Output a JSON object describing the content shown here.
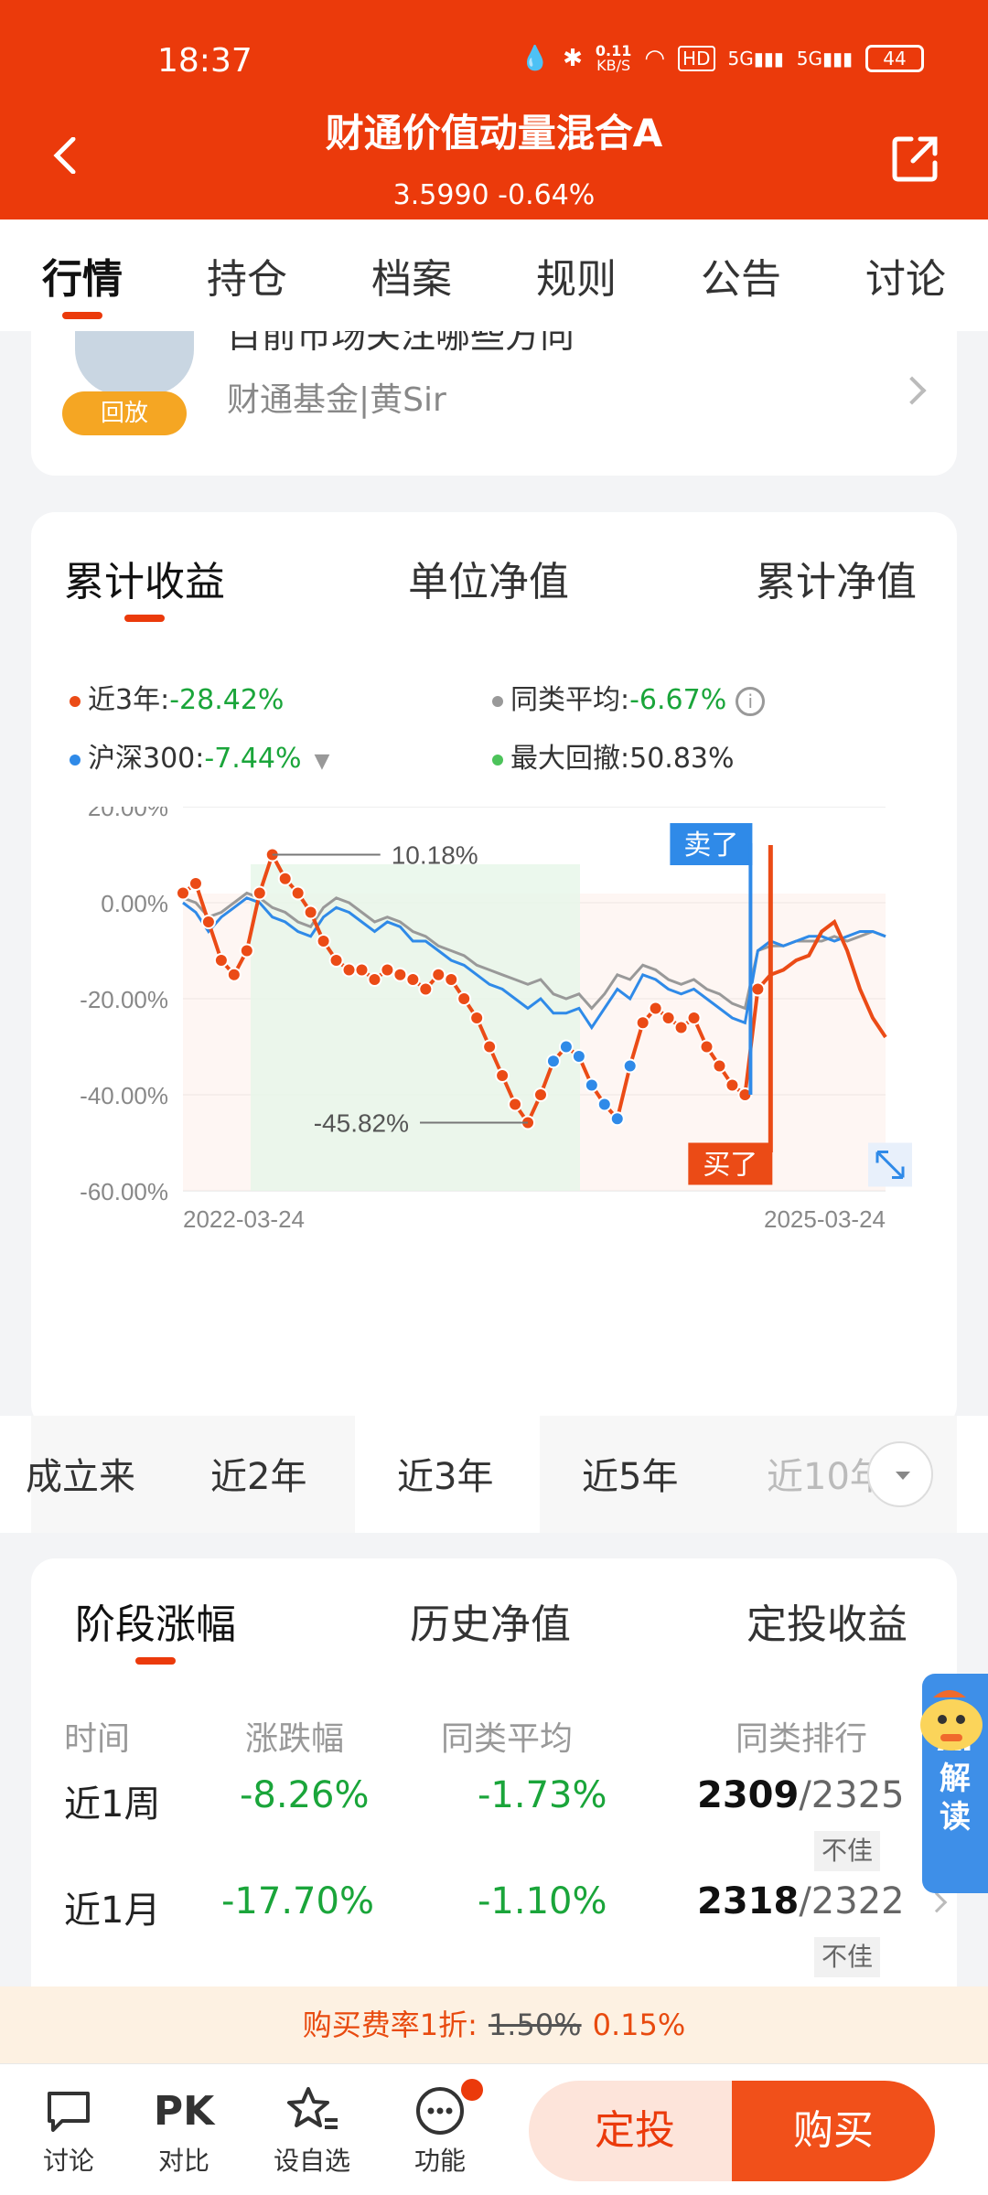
{
  "status_bar": {
    "time": "18:37",
    "net_speed_top": "0.11",
    "net_speed_unit": "KB/S",
    "battery": "44"
  },
  "header": {
    "title": "财通价值动量混合A",
    "subtitle": "3.5990 -0.64%"
  },
  "tabs": [
    {
      "label": "行情",
      "active": true
    },
    {
      "label": "持仓"
    },
    {
      "label": "档案"
    },
    {
      "label": "规则"
    },
    {
      "label": "公告"
    },
    {
      "label": "讨论"
    }
  ],
  "live": {
    "title": "目前市场关注哪些方向",
    "author": "财通基金|黄Sir",
    "badge": "回放"
  },
  "chart_tabs": [
    "累计收益",
    "单位净值",
    "累计净值"
  ],
  "legend": {
    "fund": {
      "label": "近3年:",
      "value": "-28.42%",
      "color": "#eb4b16"
    },
    "peer": {
      "label": "同类平均:",
      "value": "-6.67%",
      "color": "#999999"
    },
    "index": {
      "label": "沪深300:",
      "value": "-7.44%",
      "color": "#2f8ae8"
    },
    "drawdown": {
      "label": "最大回撤:",
      "value": "50.83%",
      "color": "#4cc35a"
    }
  },
  "chart_data": {
    "type": "line",
    "y_ticks": [
      "20.00%",
      "0.00%",
      "-20.00%",
      "-40.00%",
      "-60.00%"
    ],
    "ylim": [
      -60,
      20
    ],
    "x_ticks": [
      "2022-03-24",
      "2025-03-24"
    ],
    "annotations": {
      "max": "10.18%",
      "min": "-45.82%",
      "sell": "卖了",
      "buy": "买了"
    },
    "series": [
      {
        "name": "近3年",
        "color": "#eb4b16",
        "values": [
          2,
          4,
          -4,
          -12,
          -15,
          -10,
          2,
          10,
          5,
          2,
          -2,
          -8,
          -12,
          -14,
          -14,
          -16,
          -14,
          -15,
          -16,
          -18,
          -15,
          -16,
          -20,
          -24,
          -30,
          -36,
          -42,
          -45.8,
          -40,
          -33,
          -30,
          -32,
          -38,
          -42,
          -45,
          -34,
          -25,
          -22,
          -24,
          -26,
          -24,
          -30,
          -34,
          -38,
          -40,
          -18,
          -15,
          -14,
          -12,
          -11,
          -6,
          -4,
          -10,
          -18,
          -24,
          -28
        ]
      },
      {
        "name": "沪深300",
        "color": "#2f8ae8",
        "values": [
          0,
          -2,
          -6,
          -3,
          -1,
          1,
          0,
          -3,
          -4,
          -6,
          -7,
          -3,
          -1,
          -2,
          -4,
          -6,
          -4,
          -5,
          -8,
          -8,
          -10,
          -12,
          -13,
          -15,
          -17,
          -18,
          -20,
          -22,
          -20,
          -23,
          -23,
          -22,
          -26,
          -22,
          -18,
          -20,
          -15,
          -16,
          -18,
          -19,
          -18,
          -20,
          -22,
          -24,
          -25,
          -10,
          -8,
          -9,
          -8,
          -7,
          -7,
          -8,
          -7,
          -6,
          -6,
          -7
        ]
      },
      {
        "name": "同类平均",
        "color": "#999999",
        "values": [
          1,
          0,
          -3,
          -2,
          0,
          2,
          1,
          -1,
          -2,
          -4,
          -5,
          -1,
          1,
          0,
          -2,
          -4,
          -3,
          -4,
          -6,
          -7,
          -9,
          -10,
          -11,
          -13,
          -14,
          -15,
          -16,
          -17,
          -16,
          -19,
          -20,
          -19,
          -22,
          -19,
          -15,
          -16,
          -13,
          -14,
          -16,
          -17,
          -16,
          -18,
          -19,
          -21,
          -22,
          -10,
          -9,
          -9,
          -8,
          -8,
          -8,
          -7,
          -8,
          -7,
          -6,
          -7
        ]
      }
    ]
  },
  "periods": [
    "成立来",
    "近2年",
    "近3年",
    "近5年",
    "近10年"
  ],
  "stage_tabs": [
    "阶段涨幅",
    "历史净值",
    "定投收益"
  ],
  "stage_table": {
    "headers": [
      "时间",
      "涨跌幅",
      "同类平均",
      "同类排行"
    ],
    "rows": [
      {
        "period": "近1周",
        "change": "-8.26%",
        "avg": "-1.73%",
        "rank": "2309",
        "total": "/2325",
        "level": "不佳"
      },
      {
        "period": "近1月",
        "change": "-17.70%",
        "avg": "-1.10%",
        "rank": "2318",
        "total": "/2322",
        "level": "不佳"
      }
    ]
  },
  "fee": {
    "label": "购买费率1折:",
    "original": "1.50%",
    "discounted": "0.15%"
  },
  "bottom_nav": [
    {
      "label": "讨论",
      "icon": "chat-icon"
    },
    {
      "label": "对比",
      "icon_text": "PK"
    },
    {
      "label": "设自选",
      "icon": "star-list-icon"
    },
    {
      "label": "功能",
      "icon": "more-icon"
    }
  ],
  "actions": {
    "sip": "定投",
    "buy": "购买"
  },
  "ai_button": "AI解读"
}
